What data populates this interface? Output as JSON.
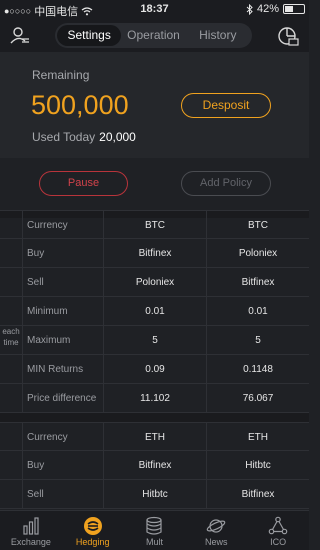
{
  "status": {
    "carrier": "中国电信",
    "time": "18:37",
    "battery": "42%",
    "battery_level": 0.42
  },
  "nav": {
    "tabs": [
      "Settings",
      "Operation",
      "History"
    ],
    "active_tab": 0
  },
  "summary": {
    "remaining_label": "Remaining",
    "remaining_value": "500,000",
    "deposit_label": "Desposit",
    "used_label": "Used Today",
    "used_value": "20,000"
  },
  "actions": {
    "pause_label": "Pause",
    "add_policy_label": "Add Policy"
  },
  "policy1": {
    "each_time_label": "each time",
    "rows": [
      {
        "label": "Currency",
        "a": "BTC",
        "b": "BTC"
      },
      {
        "label": "Buy",
        "a": "Bitfinex",
        "b": "Poloniex"
      },
      {
        "label": "Sell",
        "a": "Poloniex",
        "b": "Bitfinex"
      },
      {
        "label": "Minimum",
        "a": "0.01",
        "b": "0.01"
      },
      {
        "label": "Maximum",
        "a": "5",
        "b": "5"
      },
      {
        "label": "MIN Returns",
        "a": "0.09",
        "b": "0.1148"
      },
      {
        "label": "Price difference",
        "a": "11.102",
        "b": "76.067"
      }
    ]
  },
  "policy2": {
    "rows": [
      {
        "label": "Currency",
        "a": "ETH",
        "b": "ETH"
      },
      {
        "label": "Buy",
        "a": "Bitfinex",
        "b": "Hitbtc"
      },
      {
        "label": "Sell",
        "a": "Hitbtc",
        "b": "Bitfinex"
      }
    ]
  },
  "tabbar": {
    "items": [
      {
        "label": "Exchange",
        "icon": "bar-chart-icon"
      },
      {
        "label": "Hedging",
        "icon": "hedging-icon"
      },
      {
        "label": "Mult",
        "icon": "database-icon"
      },
      {
        "label": "News",
        "icon": "planet-icon"
      },
      {
        "label": "ICO",
        "icon": "nodes-icon"
      }
    ],
    "active": 1
  },
  "colors": {
    "accent": "#f0a21f",
    "danger": "#d2434b",
    "background": "#1f2125"
  }
}
